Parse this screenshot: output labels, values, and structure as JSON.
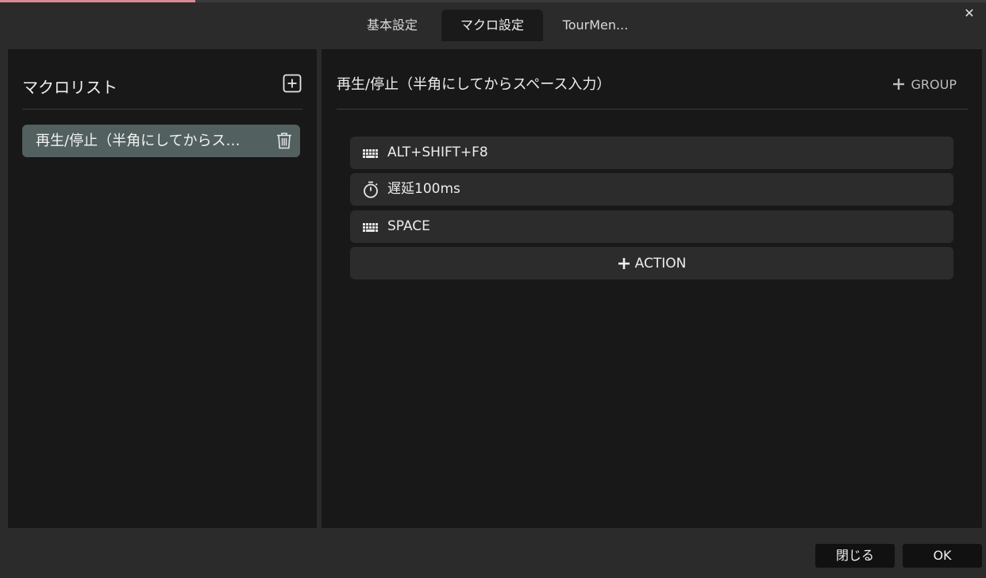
{
  "tabs": [
    {
      "label": "基本設定"
    },
    {
      "label": "マクロ設定"
    },
    {
      "label": "TourMen..."
    }
  ],
  "window": {
    "close_icon": "close-icon"
  },
  "left_panel": {
    "title": "マクロリスト",
    "add_icon": "plus-square-icon",
    "items": [
      {
        "label": "再生/停止（半角にしてからス…",
        "delete_icon": "trash-icon"
      }
    ]
  },
  "right_panel": {
    "title": "再生/停止（半角にしてからスペース入力）",
    "group_button_label": "GROUP",
    "actions": [
      {
        "icon": "keyboard-icon",
        "label": "ALT+SHIFT+F8"
      },
      {
        "icon": "stopwatch-icon",
        "label": "遅延100ms"
      },
      {
        "icon": "keyboard-icon",
        "label": "SPACE"
      }
    ],
    "add_action_label": "ACTION"
  },
  "footer": {
    "close_label": "閉じる",
    "ok_label": "OK"
  },
  "colors": {
    "selected_item": "#52605f",
    "panel_bg": "#181818",
    "window_bg": "#2b2b2b"
  }
}
